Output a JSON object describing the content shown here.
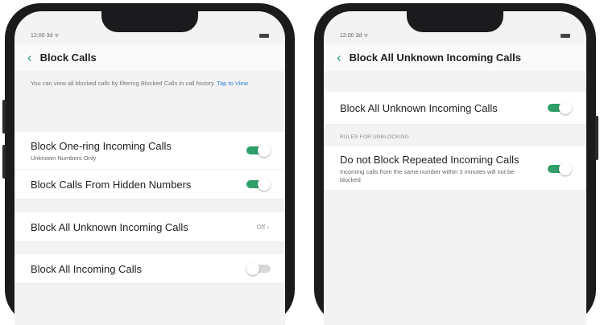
{
  "left": {
    "status_time": "12:00 3d ᯤ",
    "title": "Block Calls",
    "note": "You can view all blocked calls by filtering Blocked Calls in call history.",
    "note_link": "Tap to View",
    "rows": [
      {
        "label": "Block One-ring Incoming Calls",
        "sub": "Unknown Numbers Only",
        "toggle": true
      },
      {
        "label": "Block Calls From Hidden Numbers",
        "toggle": true
      },
      {
        "label": "Block All Unknown Incoming Calls",
        "value": "Off ›"
      },
      {
        "label": "Block All Incoming Calls",
        "toggle": false
      }
    ]
  },
  "right": {
    "status_time": "12:00 3d ᯤ",
    "title": "Block All Unknown Incoming Calls",
    "rows": [
      {
        "label": "Block All Unknown Incoming Calls",
        "toggle": true
      }
    ],
    "section_label": "RULES FOR UNBLOCKING",
    "rule": {
      "label": "Do not Block Repeated Incoming Calls",
      "sub": "Incoming calls from the same number within 3 minutes will not be blocked",
      "toggle": true
    }
  },
  "colors": {
    "accent": "#2f9e68",
    "link": "#2a83d9",
    "background": "#f3f3f3"
  },
  "icons": {
    "back": "chevron-left-icon",
    "battery": "battery-icon",
    "signal": "signal-icon"
  }
}
